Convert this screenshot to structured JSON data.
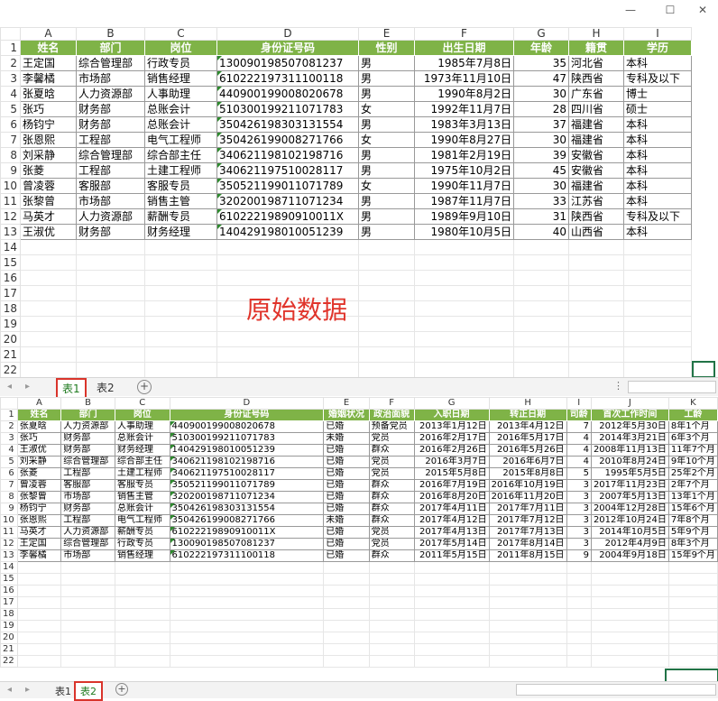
{
  "window": {
    "minimize_label": "—",
    "maximize_label": "☐",
    "close_label": "✕"
  },
  "annotation": "原始数据",
  "sheet1": {
    "col_letters": [
      "A",
      "B",
      "C",
      "D",
      "E",
      "F",
      "G",
      "H",
      "I"
    ],
    "headers": [
      "姓名",
      "部门",
      "岗位",
      "身份证号码",
      "性别",
      "出生日期",
      "年龄",
      "籍贯",
      "学历"
    ],
    "rows": [
      [
        "王定国",
        "综合管理部",
        "行政专员",
        "130090198507081237",
        "男",
        "1985年7月8日",
        "35",
        "河北省",
        "本科"
      ],
      [
        "李馨橘",
        "市场部",
        "销售经理",
        "610222197311100118",
        "男",
        "1973年11月10日",
        "47",
        "陕西省",
        "专科及以下"
      ],
      [
        "张夏晗",
        "人力资源部",
        "人事助理",
        "440900199008020678",
        "男",
        "1990年8月2日",
        "30",
        "广东省",
        "博士"
      ],
      [
        "张巧",
        "财务部",
        "总账会计",
        "510300199211071783",
        "女",
        "1992年11月7日",
        "28",
        "四川省",
        "硕士"
      ],
      [
        "杨钧宁",
        "财务部",
        "总账会计",
        "350426198303131554",
        "男",
        "1983年3月13日",
        "37",
        "福建省",
        "本科"
      ],
      [
        "张恩熙",
        "工程部",
        "电气工程师",
        "350426199008271766",
        "女",
        "1990年8月27日",
        "30",
        "福建省",
        "本科"
      ],
      [
        "刘采静",
        "综合管理部",
        "综合部主任",
        "340621198102198716",
        "男",
        "1981年2月19日",
        "39",
        "安徽省",
        "本科"
      ],
      [
        "张菱",
        "工程部",
        "土建工程师",
        "340621197510028117",
        "男",
        "1975年10月2日",
        "45",
        "安徽省",
        "本科"
      ],
      [
        "曾凌蓉",
        "客服部",
        "客服专员",
        "350521199011071789",
        "女",
        "1990年11月7日",
        "30",
        "福建省",
        "本科"
      ],
      [
        "张黎曾",
        "市场部",
        "销售主管",
        "320200198711071234",
        "男",
        "1987年11月7日",
        "33",
        "江苏省",
        "本科"
      ],
      [
        "马英才",
        "人力资源部",
        "薪酬专员",
        "61022219890910011X",
        "男",
        "1989年9月10日",
        "31",
        "陕西省",
        "专科及以下"
      ],
      [
        "王淑优",
        "财务部",
        "财务经理",
        "140429198010051239",
        "男",
        "1980年10月5日",
        "40",
        "山西省",
        "本科"
      ]
    ],
    "empty_rows": [
      "14",
      "15",
      "16",
      "17",
      "18",
      "19",
      "20",
      "21",
      "22"
    ],
    "tabs": [
      "表1",
      "表2"
    ],
    "active_tab": "表1"
  },
  "sheet2": {
    "col_letters": [
      "A",
      "B",
      "C",
      "D",
      "E",
      "F",
      "G",
      "H",
      "I",
      "J",
      "K"
    ],
    "headers": [
      "姓名",
      "部门",
      "岗位",
      "身份证号码",
      "婚姻状况",
      "政治面貌",
      "入职日期",
      "转正日期",
      "司龄",
      "首次工作时间",
      "工龄"
    ],
    "rows": [
      [
        "张夏晗",
        "人力资源部",
        "人事助理",
        "440900199008020678",
        "已婚",
        "预备党员",
        "2013年1月12日",
        "2013年4月12日",
        "7",
        "2012年5月30日",
        "8年1个月"
      ],
      [
        "张巧",
        "财务部",
        "总账会计",
        "510300199211071783",
        "未婚",
        "党员",
        "2016年2月17日",
        "2016年5月17日",
        "4",
        "2014年3月21日",
        "6年3个月"
      ],
      [
        "王淑优",
        "财务部",
        "财务经理",
        "140429198010051239",
        "已婚",
        "群众",
        "2016年2月26日",
        "2016年5月26日",
        "4",
        "2008年11月13日",
        "11年7个月"
      ],
      [
        "刘采静",
        "综合管理部",
        "综合部主任",
        "340621198102198716",
        "已婚",
        "党员",
        "2016年3月7日",
        "2016年6月7日",
        "4",
        "2010年8月24日",
        "9年10个月"
      ],
      [
        "张菱",
        "工程部",
        "土建工程师",
        "340621197510028117",
        "已婚",
        "党员",
        "2015年5月8日",
        "2015年8月8日",
        "5",
        "1995年5月5日",
        "25年2个月"
      ],
      [
        "曾凌蓉",
        "客服部",
        "客服专员",
        "350521199011071789",
        "已婚",
        "群众",
        "2016年7月19日",
        "2016年10月19日",
        "3",
        "2017年11月23日",
        "2年7个月"
      ],
      [
        "张黎曾",
        "市场部",
        "销售主管",
        "320200198711071234",
        "已婚",
        "群众",
        "2016年8月20日",
        "2016年11月20日",
        "3",
        "2007年5月13日",
        "13年1个月"
      ],
      [
        "杨钧宁",
        "财务部",
        "总账会计",
        "350426198303131554",
        "已婚",
        "群众",
        "2017年4月11日",
        "2017年7月11日",
        "3",
        "2004年12月28日",
        "15年6个月"
      ],
      [
        "张恩熙",
        "工程部",
        "电气工程师",
        "350426199008271766",
        "未婚",
        "群众",
        "2017年4月12日",
        "2017年7月12日",
        "3",
        "2012年10月24日",
        "7年8个月"
      ],
      [
        "马英才",
        "人力资源部",
        "薪酬专员",
        "61022219890910011X",
        "已婚",
        "党员",
        "2017年4月13日",
        "2017年7月13日",
        "3",
        "2014年10月5日",
        "5年9个月"
      ],
      [
        "王定国",
        "综合管理部",
        "行政专员",
        "130090198507081237",
        "已婚",
        "党员",
        "2017年5月14日",
        "2017年8月14日",
        "3",
        "2012年4月9日",
        "8年3个月"
      ],
      [
        "李馨橘",
        "市场部",
        "销售经理",
        "610222197311100118",
        "已婚",
        "群众",
        "2011年5月15日",
        "2011年8月15日",
        "9",
        "2004年9月18日",
        "15年9个月"
      ]
    ],
    "empty_rows": [
      "14",
      "15",
      "16",
      "17",
      "18",
      "19",
      "20",
      "21",
      "22"
    ],
    "tabs": [
      "表1",
      "表2"
    ],
    "active_tab": "表2"
  },
  "colors": {
    "header_green": "#7fb347",
    "highlight_red": "#d9342b",
    "annotation_red": "#e0342b"
  }
}
